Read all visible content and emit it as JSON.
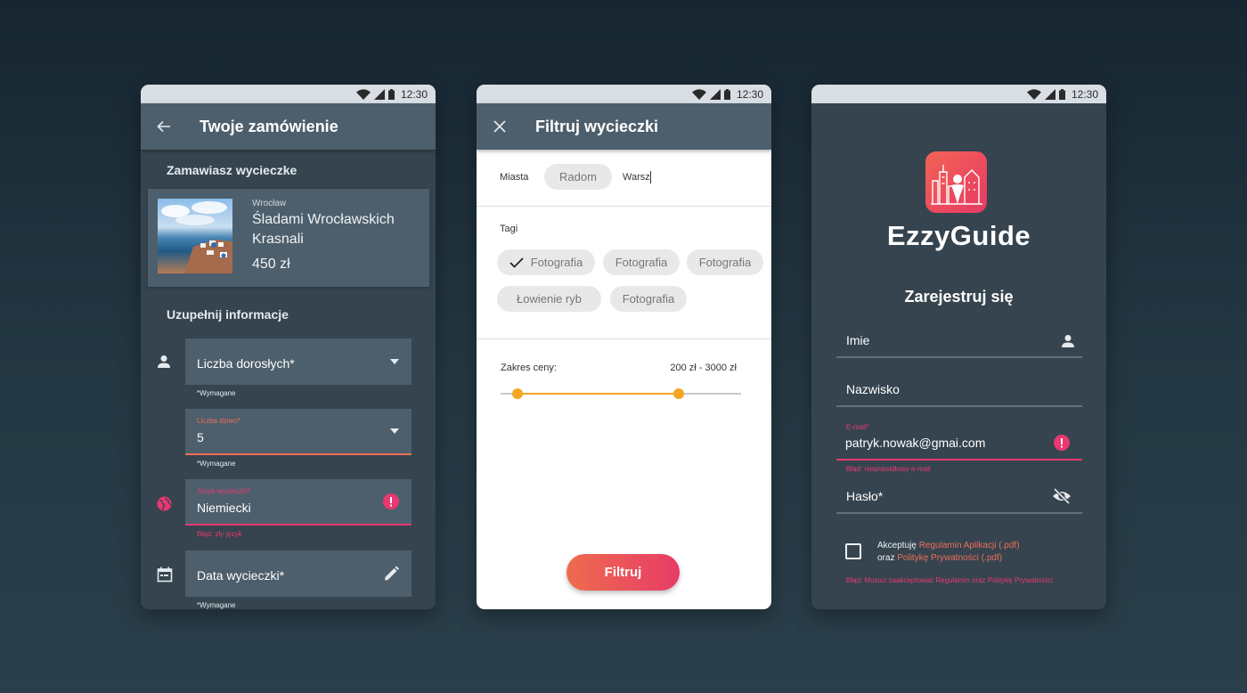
{
  "status": {
    "time": "12:30"
  },
  "colors": {
    "accent_orange": "#ef6e58",
    "accent_pink": "#e8386f",
    "slider": "#f5a623"
  },
  "order": {
    "title": "Twoje zamówienie",
    "section1": "Zamawiasz wycieczke",
    "trip": {
      "city": "Wrocław",
      "name": "Śladami Wrocławskich Krasnali",
      "price": "450 zł"
    },
    "section2": "Uzupełnij informacje",
    "adults": {
      "label": "Liczba dorosłych*",
      "helper": "*Wymagane"
    },
    "children": {
      "label": "Liczba dzieci*",
      "value": "5",
      "helper": "*Wymagane"
    },
    "language": {
      "label": "Język wycieczki*",
      "value": "Niemiecki",
      "error": "Błąd: zły język"
    },
    "date": {
      "label": "Data wycieczki*",
      "helper": "*Wymagane"
    }
  },
  "filter": {
    "title": "Filtruj wycieczki",
    "cities_label": "Miasta",
    "city_chip": "Radom",
    "city_input": "Warsz",
    "tags_label": "Tagi",
    "tags": [
      "Fotografia",
      "Fotografia",
      "Fotografia",
      "Łowienie ryb",
      "Fotografia"
    ],
    "price_label": "Zakres ceny:",
    "price_range": "200 zł - 3000 zł",
    "price_min_fraction": 0.07,
    "price_max_fraction": 0.74,
    "button": "Filtruj"
  },
  "register": {
    "brand": "EzzyGuide",
    "heading": "Zarejestruj się",
    "first_name": "Imie",
    "last_name": "Nazwisko",
    "email_label": "E-mail*",
    "email_value": "patryk.nowak@gmai.com",
    "email_error": "Błąd: nieprawidłowy e-mail",
    "password": "Hasło*",
    "consent_prefix": "Akceptuję",
    "consent_link1": "Regulamin Aplikacji (.pdf)",
    "consent_mid": "oraz",
    "consent_link2": "Politykę Prywatności (.pdf)",
    "consent_error": "Błąd: Musisz zaakceptować Regulamin oraz Politykę Prywatności"
  }
}
